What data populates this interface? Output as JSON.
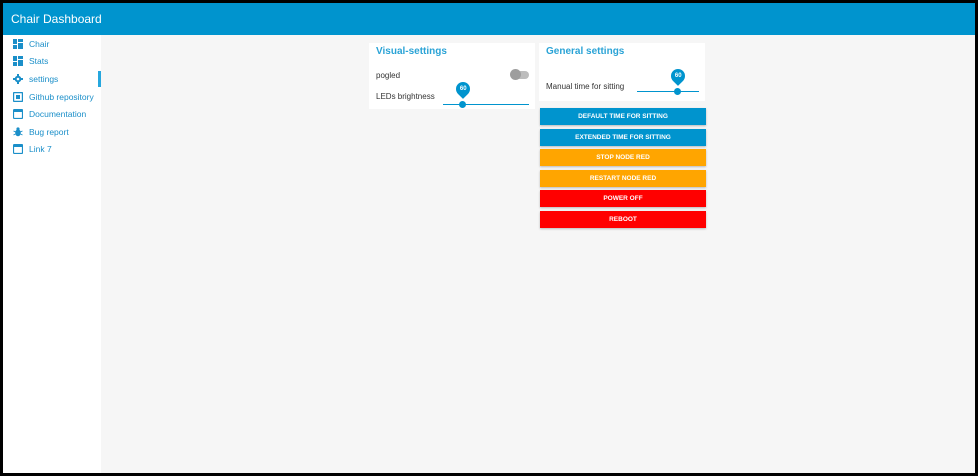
{
  "app": {
    "title": "Chair Dashboard"
  },
  "sidebar": {
    "items": [
      {
        "label": "Chair",
        "icon": "dashboard-icon"
      },
      {
        "label": "Stats",
        "icon": "dashboard-icon"
      },
      {
        "label": "settings",
        "icon": "gear-icon",
        "active": true
      },
      {
        "label": "Github repository",
        "icon": "square-icon"
      },
      {
        "label": "Documentation",
        "icon": "browser-window-icon"
      },
      {
        "label": "Bug report",
        "icon": "bug-icon"
      },
      {
        "label": "Link 7",
        "icon": "browser-window-icon"
      }
    ]
  },
  "visual_settings": {
    "title": "Visual-settings",
    "toggle_label": "pogled",
    "toggle_on": false,
    "brightness_label": "LEDs brightness",
    "brightness_value": "60",
    "brightness_fraction": 0.23
  },
  "general_settings": {
    "title": "General settings",
    "manual_label": "Manual time for sitting",
    "manual_value": "60",
    "manual_fraction": 0.66,
    "buttons": [
      {
        "label": "DEFAULT TIME FOR SITTING",
        "color": "#0094ce"
      },
      {
        "label": "EXTENDED TIME FOR SITTING",
        "color": "#0094ce"
      },
      {
        "label": "STOP NODE RED",
        "color": "#ffa500"
      },
      {
        "label": "RESTART NODE RED",
        "color": "#ffa500"
      },
      {
        "label": "POWER OFF",
        "color": "#ff0000"
      },
      {
        "label": "REBOOT",
        "color": "#ff0000"
      }
    ]
  },
  "colors": {
    "accent": "#0094ce",
    "title": "#2aa3d6",
    "link": "#1b8fc9"
  }
}
